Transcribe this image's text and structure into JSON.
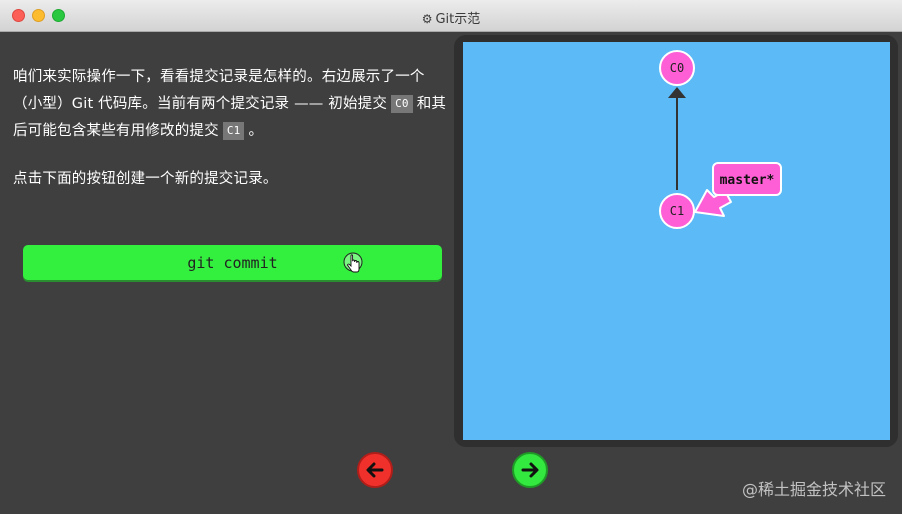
{
  "window": {
    "title": "Git示范"
  },
  "description": {
    "para1_part1": "咱们来实际操作一下，看看提交记录是怎样的。右边展示了一个（小型）Git 代码库。当前有两个提交记录 —— 初始提交",
    "para1_chip1": "C0",
    "para1_part2": "和其后可能包含某些有用修改的提交",
    "para1_chip2": "C1",
    "para1_part3": "。",
    "para2": "点击下面的按钮创建一个新的提交记录。"
  },
  "commit_button": {
    "label": "git commit"
  },
  "graph": {
    "commits": [
      {
        "id": "C0"
      },
      {
        "id": "C1"
      }
    ],
    "branch_label": "master*",
    "colors": {
      "background": "#5cbaf7",
      "node": "#ff5fd6",
      "node_border": "#ffffff",
      "edge": "#333333"
    }
  },
  "navigation": {
    "back_icon": "arrow-left-icon",
    "forward_icon": "arrow-right-icon"
  },
  "watermark": "@稀土掘金技术社区"
}
